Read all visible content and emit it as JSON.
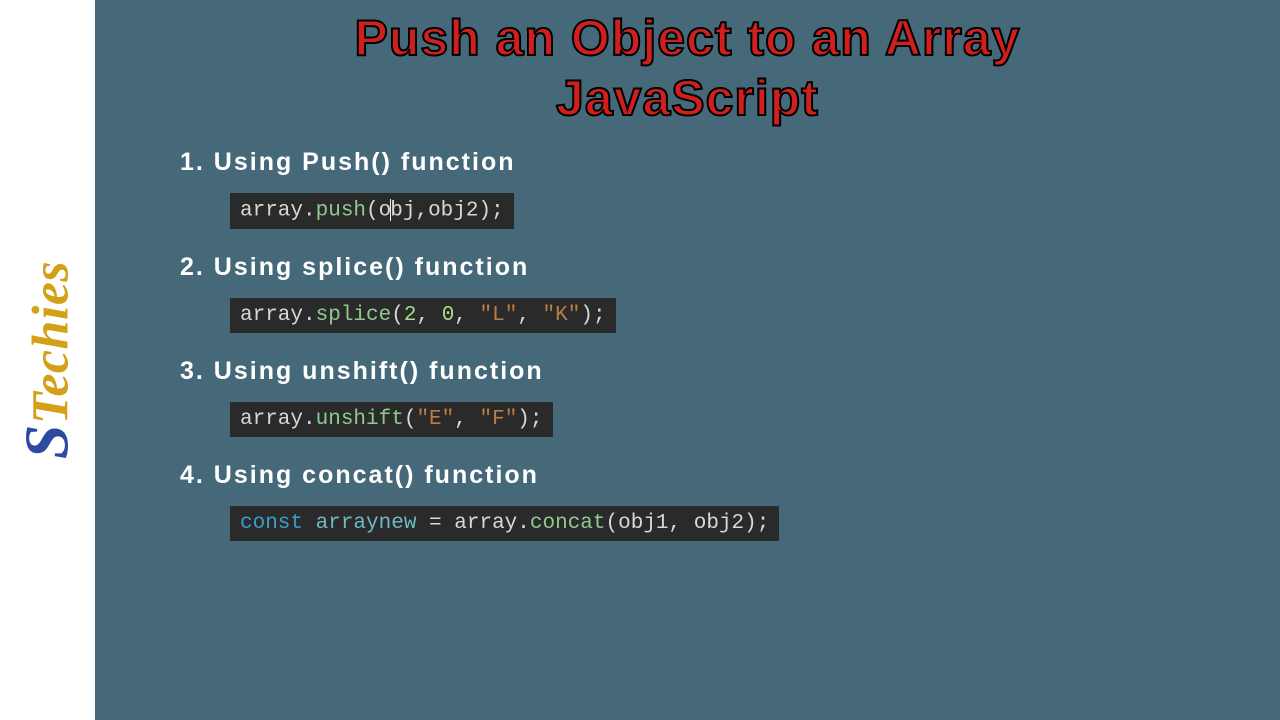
{
  "logo": {
    "s": "S",
    "t": "T",
    "rest": "echies"
  },
  "title_line1": "Push an Object to an Array",
  "title_line2": "JavaScript",
  "sections": [
    {
      "heading": "1. Using Push() function",
      "code": {
        "obj": "array",
        "dot1": ".",
        "fn": "push",
        "open": "(",
        "arg_pre": "o",
        "arg_post": "bj,obj2",
        "close": ");"
      }
    },
    {
      "heading": "2. Using splice() function",
      "code": {
        "obj": "array",
        "dot1": ".",
        "fn": "splice",
        "open": "(",
        "n1": "2",
        "c1": ", ",
        "n2": "0",
        "c2": ", ",
        "s1": "\"L\"",
        "c3": ", ",
        "s2": "\"K\"",
        "close": ");"
      }
    },
    {
      "heading": "3. Using unshift() function",
      "code": {
        "obj": "array",
        "dot1": ".",
        "fn": "unshift",
        "open": "(",
        "s1": "\"E\"",
        "c1": ", ",
        "s2": "\"F\"",
        "close": ");"
      }
    },
    {
      "heading": "4. Using concat() function",
      "code": {
        "kw": "const",
        "sp1": " ",
        "var": "arraynew",
        "eq": " = ",
        "obj": "array",
        "dot1": ".",
        "fn": "concat",
        "open": "(",
        "args": "obj1, obj2",
        "close": ");"
      }
    }
  ]
}
